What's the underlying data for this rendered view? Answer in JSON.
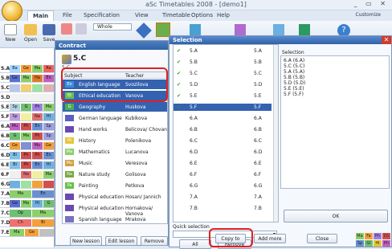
{
  "app": {
    "title": "aSc Timetables 2008 - [demo1]",
    "customize": "Customize"
  },
  "menu": [
    "Main",
    "File",
    "Specification",
    "View",
    "Timetable",
    "Options",
    "Help"
  ],
  "ribbon": {
    "new": "New",
    "open": "Open",
    "save": "Save",
    "whole": "Whole"
  },
  "grid_rows": [
    {
      "cls": "5.A",
      "cells": [
        {
          "t": "Ba",
          "c": "#a8d8ff"
        },
        {
          "t": "Ge",
          "c": "#f4a03a"
        },
        {
          "t": "Ma",
          "c": "#8bd06a"
        },
        {
          "t": "Ra",
          "c": "#ee6363"
        }
      ]
    },
    {
      "cls": "5.B",
      "cells": [
        {
          "t": "Ge",
          "c": "#5a70d0"
        },
        {
          "t": "Ma",
          "c": "#8bd06a"
        },
        {
          "t": "Ha",
          "c": "#e07a2a"
        },
        {
          "t": "En",
          "c": "#c060c0"
        }
      ]
    },
    {
      "cls": "5.C",
      "cells": [
        {
          "t": "",
          "c": "#b8c8e8"
        },
        {
          "t": "",
          "c": "#f0d070"
        },
        {
          "t": "",
          "c": "#a0e0a0"
        },
        {
          "t": "",
          "c": "#e0b0b0"
        }
      ]
    },
    {
      "cls": "5.D",
      "cells": [
        {
          "t": "",
          "c": "#f2f2f2"
        }
      ]
    },
    {
      "cls": "5.E",
      "cells": [
        {
          "t": "Sp",
          "c": "#b0d0e0"
        },
        {
          "t": "G",
          "c": "#70c070"
        },
        {
          "t": "Ph",
          "c": "#a080e0"
        },
        {
          "t": "Ma",
          "c": "#8bd06a"
        }
      ]
    },
    {
      "cls": "5.F",
      "cells": [
        {
          "t": "Sp",
          "c": "#c0a0e0"
        },
        {
          "t": "",
          "c": "#f0f0a0"
        },
        {
          "t": "Na",
          "c": "#e07070"
        },
        {
          "t": "Hi",
          "c": "#70b0e0"
        }
      ]
    },
    {
      "cls": "6.A",
      "cells": [
        {
          "t": "Mu",
          "c": "#c060c0"
        },
        {
          "t": "Ph",
          "c": "#d05050"
        },
        {
          "t": "En",
          "c": "#6a90d0"
        },
        {
          "t": "Sp",
          "c": "#a0a0e0"
        }
      ]
    },
    {
      "cls": "6.B",
      "cells": [
        {
          "t": "G",
          "c": "#70c070"
        },
        {
          "t": "Ma",
          "c": "#8bd06a"
        },
        {
          "t": "Ph",
          "c": "#d05050"
        },
        {
          "t": "Sp",
          "c": "#a0a0e0"
        }
      ]
    },
    {
      "cls": "6.C",
      "cells": [
        {
          "t": "Ge",
          "c": "#f4a03a"
        },
        {
          "t": "",
          "c": "#8090d0"
        },
        {
          "t": "Mu",
          "c": "#c060c0"
        },
        {
          "t": "Ge",
          "c": "#f4a03a"
        }
      ]
    },
    {
      "cls": "6.D",
      "cells": [
        {
          "t": "Bi",
          "c": "#7fc1e9"
        },
        {
          "t": "Ph",
          "c": "#d05050"
        },
        {
          "t": "Ph",
          "c": "#d05050"
        },
        {
          "t": "En",
          "c": "#6a90d0"
        }
      ]
    },
    {
      "cls": "6.E",
      "cells": [
        {
          "t": "Bi",
          "c": "#7fc1e9"
        },
        {
          "t": "Ph",
          "c": "#d05050"
        },
        {
          "t": "En",
          "c": "#6a90d0"
        },
        {
          "t": "Hi",
          "c": "#70b0e0"
        }
      ]
    },
    {
      "cls": "6.F",
      "cells": [
        {
          "t": "",
          "c": "#f0f0f0"
        },
        {
          "t": "Na",
          "c": "#e07070"
        },
        {
          "t": "",
          "c": "#f0f0a0"
        },
        {
          "t": "Ma",
          "c": "#8bd06a"
        }
      ]
    },
    {
      "cls": "6.G",
      "cells": [
        {
          "t": "",
          "c": "#70b0e0"
        },
        {
          "t": "",
          "c": "#a0e0a0"
        },
        {
          "t": "",
          "c": "#f4a03a"
        },
        {
          "t": "",
          "c": "#d05050"
        }
      ]
    },
    {
      "cls": "7.A",
      "cells": [
        {
          "t": "Ma",
          "c": "#8bd06a"
        },
        {
          "t": "En",
          "c": "#6a90d0"
        }
      ]
    },
    {
      "cls": "7.B",
      "cells": [
        {
          "t": "Ge",
          "c": "#5a70d0"
        },
        {
          "t": "Ma",
          "c": "#8bd06a"
        },
        {
          "t": "Hi",
          "c": "#70b0e0"
        },
        {
          "t": "G",
          "c": "#70c070"
        }
      ]
    },
    {
      "cls": "7.C",
      "cells": [
        {
          "t": "Op",
          "c": "#70c070"
        },
        {
          "t": "Ma",
          "c": "#8bd06a"
        }
      ]
    },
    {
      "cls": "7.D",
      "cells": [
        {
          "t": "Ch",
          "c": "#f07070"
        },
        {
          "t": "Bi",
          "c": "#f4a03a"
        }
      ]
    },
    {
      "cls": "7.E",
      "cells": [
        {
          "t": "Ma",
          "c": "#8bd06a"
        },
        {
          "t": "Ge",
          "c": "#f4a03a"
        },
        {
          "t": "",
          "c": "#c0c0c0"
        }
      ]
    }
  ],
  "contract": {
    "title": "Contract",
    "class_name": "5.C",
    "class_sub": "5.C",
    "col_subject": "Subject",
    "col_teacher": "Teacher",
    "rows": [
      {
        "abbr": "En",
        "color": "#3a8ed8",
        "subject": "English language",
        "teacher": "Svozilova",
        "sel": true
      },
      {
        "abbr": "Et",
        "color": "#6abf4a",
        "subject": "Ethical education",
        "teacher": "Vanova",
        "sel": true
      },
      {
        "abbr": "G",
        "color": "#4caf50",
        "subject": "Geography",
        "teacher": "Huskova",
        "sel": true
      },
      {
        "abbr": "",
        "color": "#5a60c0",
        "subject": "German language",
        "teacher": "Kubikova",
        "sel": false
      },
      {
        "abbr": "",
        "color": "#6a4ab0",
        "subject": "Hand works",
        "teacher": "Belicova/ Chovan",
        "sel": false
      },
      {
        "abbr": "Hi",
        "color": "#e6c63c",
        "subject": "History",
        "teacher": "Polenikova",
        "sel": false
      },
      {
        "abbr": "Ma",
        "color": "#8bd06a",
        "subject": "Mathematics",
        "teacher": "Lucanova",
        "sel": false
      },
      {
        "abbr": "Mu",
        "color": "#d0a040",
        "subject": "Music",
        "teacher": "Veresova",
        "sel": false
      },
      {
        "abbr": "Na",
        "color": "#78a840",
        "subject": "Nature study",
        "teacher": "Golisova",
        "sel": false
      },
      {
        "abbr": "Pa",
        "color": "#6abf4a",
        "subject": "Painting",
        "teacher": "Petkova",
        "sel": false
      },
      {
        "abbr": "",
        "color": "#6a4ab0",
        "subject": "Physical education",
        "teacher": "Hosan/ Jannich",
        "sel": false
      },
      {
        "abbr": "",
        "color": "#6a4ab0",
        "subject": "Physical education",
        "teacher": "Hornakova/ Vanova",
        "sel": false
      },
      {
        "abbr": "",
        "color": "#7a70c0",
        "subject": "Spanish language",
        "teacher": "Mrakova",
        "sel": false
      }
    ],
    "buttons": {
      "new": "New lesson",
      "edit": "Edit lesson",
      "remove": "Remove"
    }
  },
  "selection": {
    "title": "Selection",
    "rows": [
      {
        "c1": "5.A",
        "c2": "5.A",
        "ck": true,
        "sel": false
      },
      {
        "c1": "5.B",
        "c2": "5.B",
        "ck": true,
        "sel": false
      },
      {
        "c1": "5.C",
        "c2": "5.C",
        "ck": true,
        "sel": false
      },
      {
        "c1": "5.D",
        "c2": "5.D",
        "ck": true,
        "sel": false
      },
      {
        "c1": "5.E",
        "c2": "5.E",
        "ck": true,
        "sel": false
      },
      {
        "c1": "5.F",
        "c2": "5.F",
        "ck": true,
        "sel": true
      },
      {
        "c1": "6.A",
        "c2": "6.A",
        "ck": false,
        "sel": false
      },
      {
        "c1": "6.B",
        "c2": "6.B",
        "ck": false,
        "sel": false
      },
      {
        "c1": "6.C",
        "c2": "6.C",
        "ck": false,
        "sel": false
      },
      {
        "c1": "6.D",
        "c2": "6.D",
        "ck": false,
        "sel": false
      },
      {
        "c1": "6.E",
        "c2": "6.E",
        "ck": false,
        "sel": false
      },
      {
        "c1": "6.F",
        "c2": "6.F",
        "ck": false,
        "sel": false
      },
      {
        "c1": "6.G",
        "c2": "6.G",
        "ck": false,
        "sel": false
      },
      {
        "c1": "7.A",
        "c2": "7.A",
        "ck": false,
        "sel": false
      },
      {
        "c1": "7.B",
        "c2": "7.B",
        "ck": false,
        "sel": false
      }
    ],
    "selected_label": "Selection",
    "selected_text": "6.A (6.A)\n5.C (5.C)\n5.A (5.A)\n5.B (5.B)\n5.D (5.D)\n5.E (5.E)\n5.F (5.F)",
    "quick_selection": "Quick selection",
    "all": "All",
    "remove": "Remove",
    "ok": "OK",
    "copy": "Copy to",
    "add_more": "Add more",
    "close": "Close"
  },
  "legend": [
    "Ma",
    "Fa",
    "Ph",
    "Ch",
    "Sp",
    "Gl",
    "Hi",
    "Ph"
  ]
}
